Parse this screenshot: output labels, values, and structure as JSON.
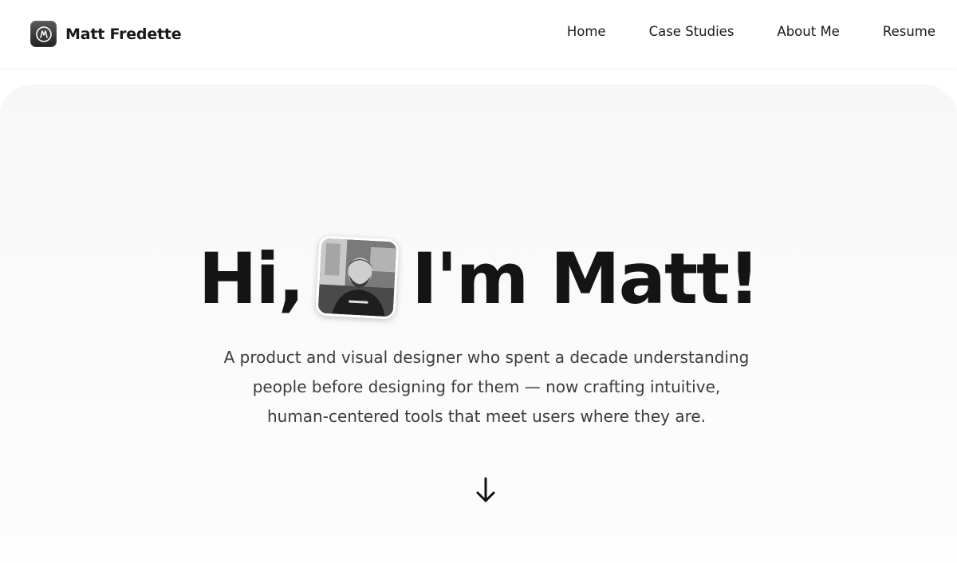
{
  "brand": {
    "name": "Matt Fredette",
    "logo_icon": "mf-monogram-icon"
  },
  "nav": {
    "items": [
      {
        "label": "Home"
      },
      {
        "label": "Case Studies"
      },
      {
        "label": "About Me"
      },
      {
        "label": "Resume"
      }
    ]
  },
  "hero": {
    "greeting": "Hi,",
    "name_text": "I'm Matt!",
    "avatar_icon": "profile-photo",
    "subtitle": "A product and visual designer who spent a decade understanding people before designing for them — now crafting intuitive, human-centered tools that meet users where they are.",
    "scroll_icon": "arrow-down-icon"
  },
  "colors": {
    "text": "#141414",
    "subtitle": "#3c3c3c",
    "hero_bg": "#f7f7f7",
    "nav_bg": "#ffffff"
  }
}
